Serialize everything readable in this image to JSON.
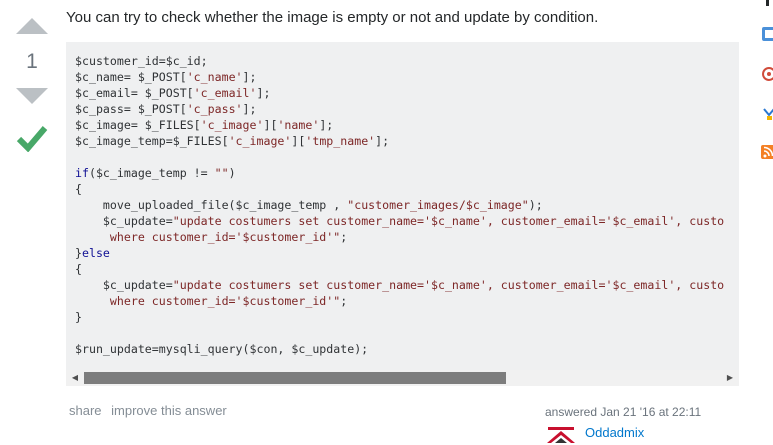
{
  "vote": {
    "count": "1",
    "accepted": true
  },
  "answer": {
    "intro": "You can try to check whether the image is empty or not and update by condition."
  },
  "code": {
    "lines": [
      [
        {
          "t": "$customer_id=$c_id;",
          "c": "pln"
        }
      ],
      [
        {
          "t": "$c_name= $_POST[",
          "c": "pln"
        },
        {
          "t": "'c_name'",
          "c": "str"
        },
        {
          "t": "];",
          "c": "pln"
        }
      ],
      [
        {
          "t": "$c_email= $_POST[",
          "c": "pln"
        },
        {
          "t": "'c_email'",
          "c": "str"
        },
        {
          "t": "];",
          "c": "pln"
        }
      ],
      [
        {
          "t": "$c_pass= $_POST[",
          "c": "pln"
        },
        {
          "t": "'c_pass'",
          "c": "str"
        },
        {
          "t": "];",
          "c": "pln"
        }
      ],
      [
        {
          "t": "$c_image= $_FILES[",
          "c": "pln"
        },
        {
          "t": "'c_image'",
          "c": "str"
        },
        {
          "t": "][",
          "c": "pln"
        },
        {
          "t": "'name'",
          "c": "str"
        },
        {
          "t": "];",
          "c": "pln"
        }
      ],
      [
        {
          "t": "$c_image_temp=$_FILES[",
          "c": "pln"
        },
        {
          "t": "'c_image'",
          "c": "str"
        },
        {
          "t": "][",
          "c": "pln"
        },
        {
          "t": "'tmp_name'",
          "c": "str"
        },
        {
          "t": "];",
          "c": "pln"
        }
      ],
      [],
      [
        {
          "t": "if",
          "c": "kw"
        },
        {
          "t": "($c_image_temp != ",
          "c": "pln"
        },
        {
          "t": "\"\"",
          "c": "str"
        },
        {
          "t": ")",
          "c": "pln"
        }
      ],
      [
        {
          "t": "{",
          "c": "pln"
        }
      ],
      [
        {
          "t": "    move_uploaded_file($c_image_temp , ",
          "c": "pln"
        },
        {
          "t": "\"customer_images/$c_image\"",
          "c": "str"
        },
        {
          "t": ");",
          "c": "pln"
        }
      ],
      [
        {
          "t": "    $c_update=",
          "c": "pln"
        },
        {
          "t": "\"update costumers set customer_name='$c_name', customer_email='$c_email', custo",
          "c": "str"
        }
      ],
      [
        {
          "t": "     where customer_id='$customer_id'\"",
          "c": "str"
        },
        {
          "t": ";",
          "c": "pln"
        }
      ],
      [
        {
          "t": "}",
          "c": "pln"
        },
        {
          "t": "else",
          "c": "kw"
        }
      ],
      [
        {
          "t": "{",
          "c": "pln"
        }
      ],
      [
        {
          "t": "    $c_update=",
          "c": "pln"
        },
        {
          "t": "\"update costumers set customer_name='$c_name', customer_email='$c_email', custo",
          "c": "str"
        }
      ],
      [
        {
          "t": "     where customer_id='$customer_id'\"",
          "c": "str"
        },
        {
          "t": ";",
          "c": "pln"
        }
      ],
      [
        {
          "t": "}",
          "c": "pln"
        }
      ],
      [],
      [
        {
          "t": "$run_update=mysqli_query($con, $c_update);",
          "c": "pln"
        }
      ]
    ]
  },
  "post_menu": {
    "share": "share",
    "improve": "improve this answer"
  },
  "user": {
    "action": "answered Jan 21 '16 at 22:11",
    "name": "Oddadmix"
  },
  "colors": {
    "accepted_check": "#48a868",
    "vote_arrow": "#bbc0c4",
    "link": "#0077cc",
    "code_bg": "#eff0f1",
    "keyword": "#101094",
    "string": "#7d2727"
  },
  "icons": [
    "arrow-up-icon",
    "arrow-down-icon",
    "accepted-check-icon",
    "scroll-left-icon",
    "scroll-right-icon",
    "rss-icon"
  ]
}
